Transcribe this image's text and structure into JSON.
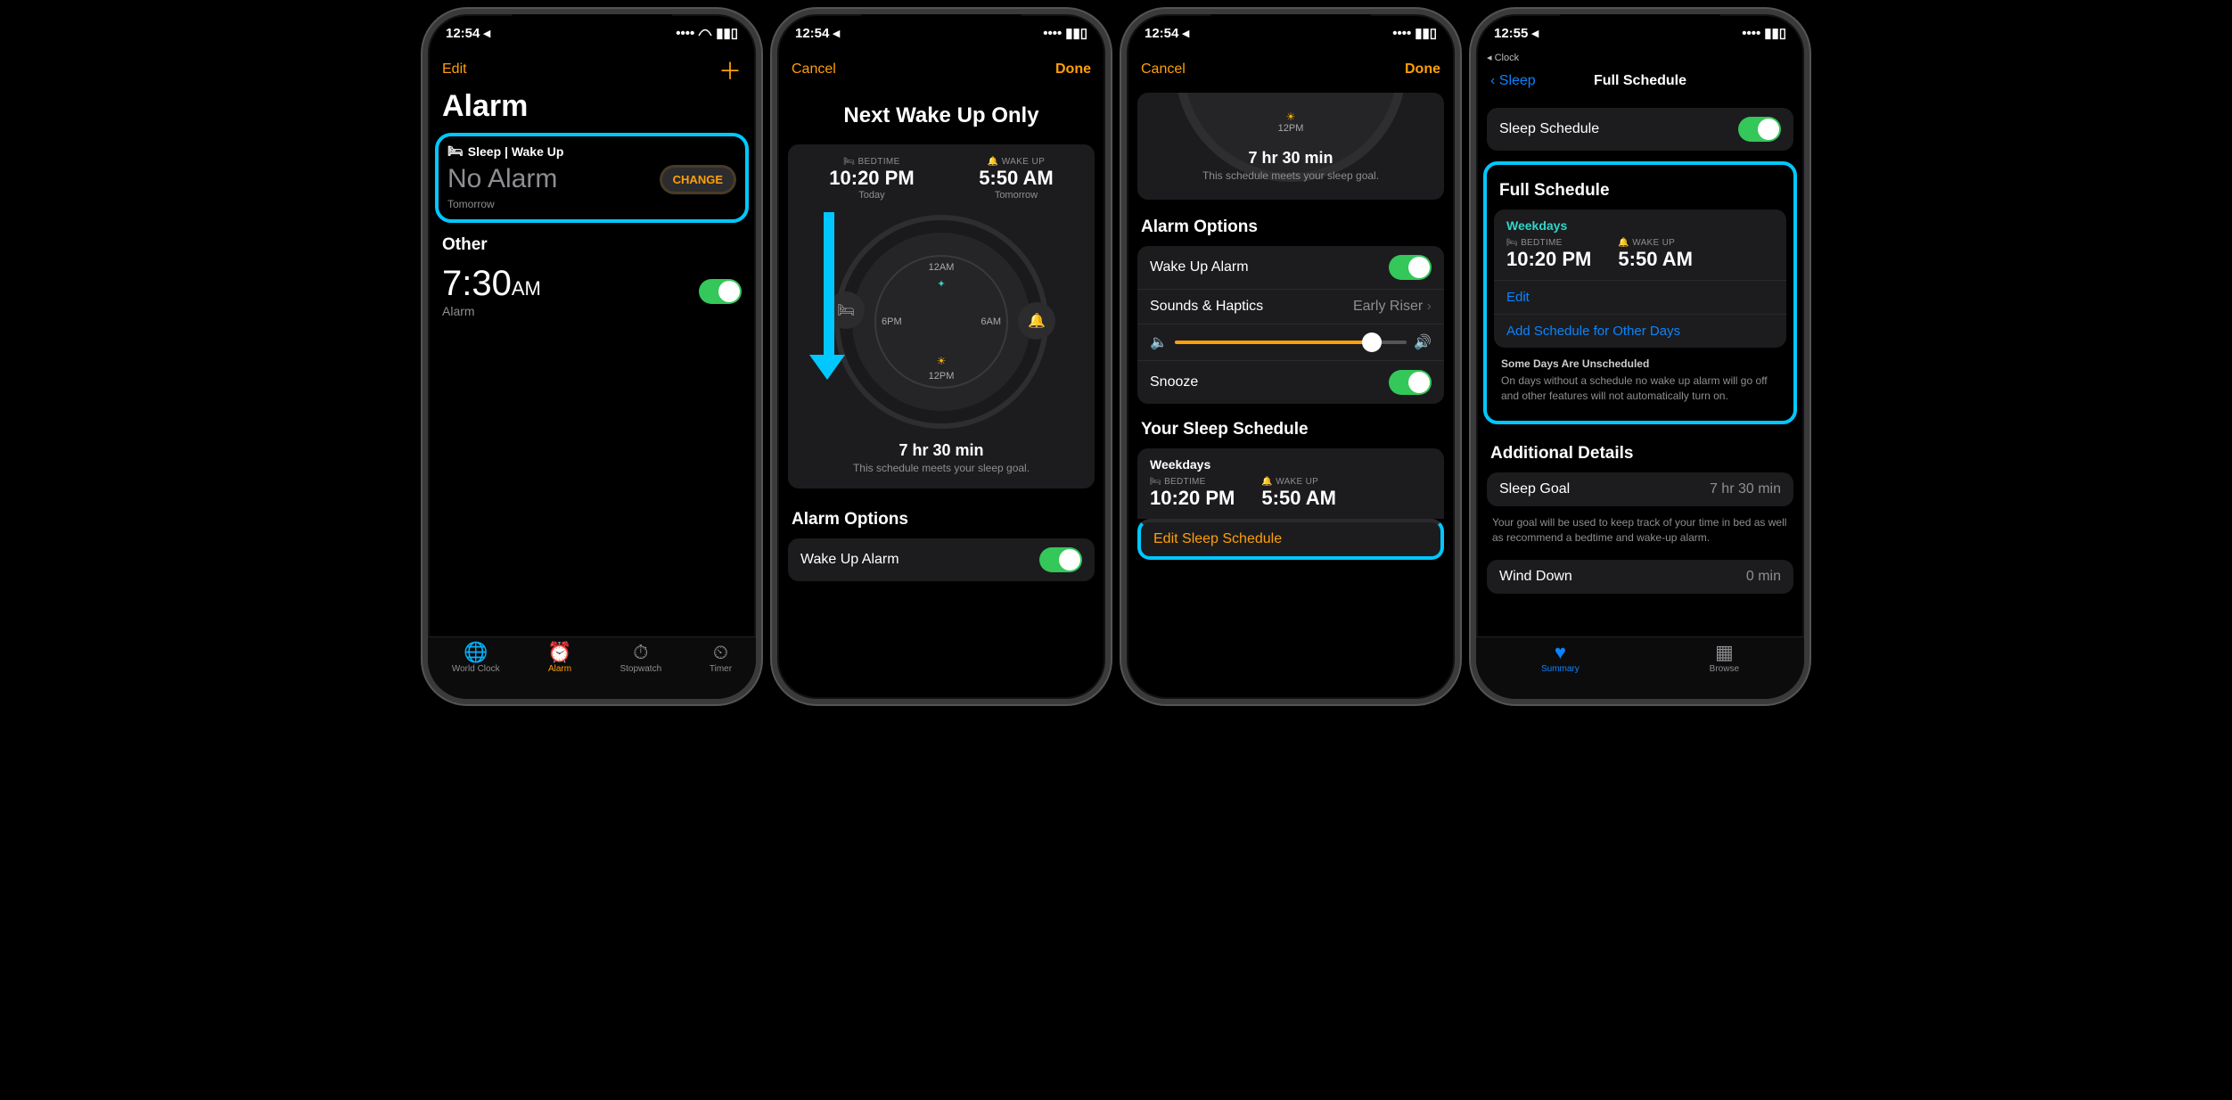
{
  "status": {
    "time1": "12:54 ◂",
    "time2": "12:54 ◂",
    "time3": "12:54 ◂",
    "time4": "12:55 ◂"
  },
  "p1": {
    "edit": "Edit",
    "title": "Alarm",
    "sleep_label": "Sleep | Wake Up",
    "no_alarm": "No Alarm",
    "tomorrow": "Tomorrow",
    "change": "CHANGE",
    "other": "Other",
    "alarm_time": "7:30",
    "alarm_ampm": "AM",
    "alarm_lbl": "Alarm",
    "tabs": {
      "world": "World Clock",
      "alarm": "Alarm",
      "stopwatch": "Stopwatch",
      "timer": "Timer"
    }
  },
  "p2": {
    "cancel": "Cancel",
    "done": "Done",
    "title": "Next Wake Up Only",
    "bed_lbl": "🛏 BEDTIME",
    "bed_time": "10:20 PM",
    "bed_sub": "Today",
    "wake_lbl": "🔔 WAKE UP",
    "wake_time": "5:50 AM",
    "wake_sub": "Tomorrow",
    "dial_12am": "12AM",
    "dial_6am": "6AM",
    "dial_12pm": "12PM",
    "dial_6pm": "6PM",
    "duration": "7 hr 30 min",
    "meets": "This schedule meets your sleep goal.",
    "alarm_options": "Alarm Options",
    "wake_up_alarm": "Wake Up Alarm"
  },
  "p3": {
    "cancel": "Cancel",
    "done": "Done",
    "duration": "7 hr 30 min",
    "meets": "This schedule meets your sleep goal.",
    "alarm_options": "Alarm Options",
    "wake_up_alarm": "Wake Up Alarm",
    "sounds": "Sounds & Haptics",
    "sounds_val": "Early Riser",
    "snooze": "Snooze",
    "your_sched": "Your Sleep Schedule",
    "weekdays": "Weekdays",
    "bed_lbl": "🛏 BEDTIME",
    "bed_time": "10:20 PM",
    "wake_lbl": "🔔 WAKE UP",
    "wake_time": "5:50 AM",
    "edit_sched": "Edit Sleep Schedule",
    "dial_12pm": "12PM"
  },
  "p4": {
    "back_app": "◂ Clock",
    "back": "Sleep",
    "title": "Full Schedule",
    "sleep_schedule": "Sleep Schedule",
    "full_schedule": "Full Schedule",
    "weekdays": "Weekdays",
    "bed_lbl": "🛏 BEDTIME",
    "bed_time": "10:20 PM",
    "wake_lbl": "🔔 WAKE UP",
    "wake_time": "5:50 AM",
    "edit": "Edit",
    "add": "Add Schedule for Other Days",
    "unsched_title": "Some Days Are Unscheduled",
    "unsched_body": "On days without a schedule no wake up alarm will go off and other features will not automatically turn on.",
    "additional": "Additional Details",
    "sleep_goal": "Sleep Goal",
    "sleep_goal_val": "7 hr 30 min",
    "goal_note": "Your goal will be used to keep track of your time in bed as well as recommend a bedtime and wake-up alarm.",
    "wind_down": "Wind Down",
    "wind_down_val": "0 min",
    "tabs": {
      "summary": "Summary",
      "browse": "Browse"
    }
  }
}
